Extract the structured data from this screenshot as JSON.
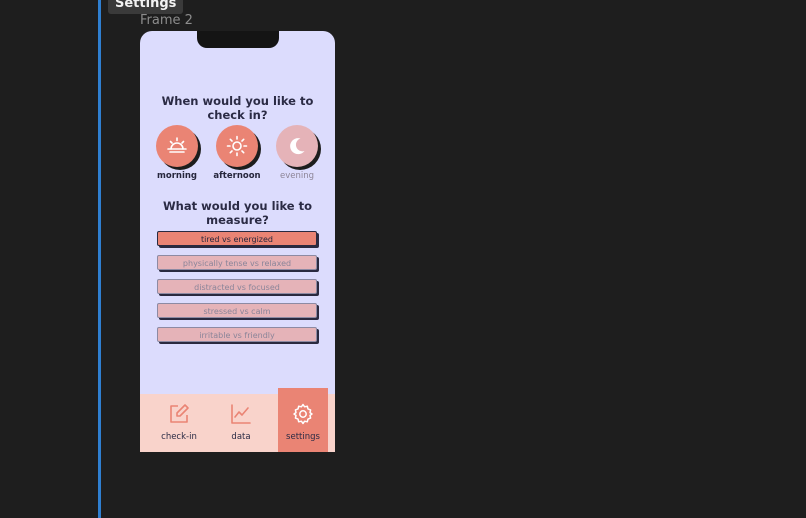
{
  "canvas": {
    "selection_tag": "Settings",
    "frame_label": "Frame 2"
  },
  "screen": {
    "checkin_question": "When would you like to check in?",
    "times": [
      {
        "label": "morning",
        "icon": "sunrise-icon",
        "active": true
      },
      {
        "label": "afternoon",
        "icon": "sun-icon",
        "active": true
      },
      {
        "label": "evening",
        "icon": "moon-icon",
        "active": false
      }
    ],
    "measure_question": "What would you like to measure?",
    "measures": [
      {
        "label": "tired vs energized",
        "active": true
      },
      {
        "label": "physically tense vs relaxed",
        "active": false
      },
      {
        "label": "distracted vs focused",
        "active": false
      },
      {
        "label": "stressed vs calm",
        "active": false
      },
      {
        "label": "irritable vs friendly",
        "active": false
      }
    ]
  },
  "nav": {
    "items": [
      {
        "label": "check-in",
        "icon": "edit-icon"
      },
      {
        "label": "data",
        "icon": "chart-line-icon"
      },
      {
        "label": "settings",
        "icon": "gear-icon",
        "active": true
      }
    ]
  },
  "colors": {
    "accent": "#ea8474",
    "inactive": "#e5b3b8",
    "screen_bg": "#dcdcfd",
    "nav_bg": "#f9d3cb",
    "selection_line": "#2f7fd1"
  }
}
